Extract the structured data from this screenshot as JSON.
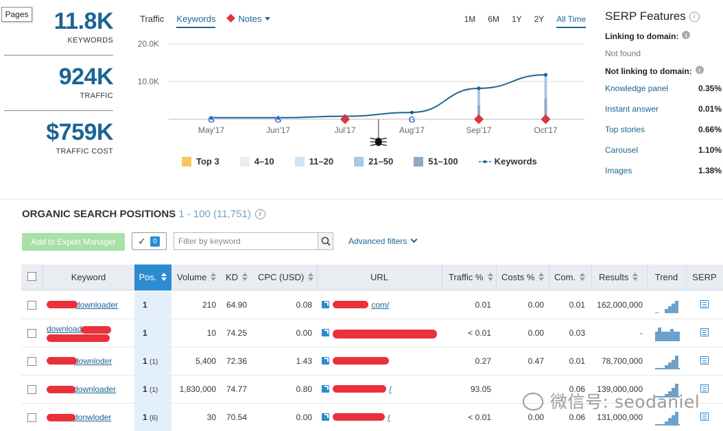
{
  "pages_tab": "Pages",
  "stats": [
    {
      "value": "11.8K",
      "label": "KEYWORDS"
    },
    {
      "value": "924K",
      "label": "TRAFFIC"
    },
    {
      "value": "$759K",
      "label": "TRAFFIC COST"
    }
  ],
  "chart_tabs": {
    "traffic": "Traffic",
    "keywords": "Keywords",
    "notes": "Notes"
  },
  "time_ranges": [
    "1M",
    "6M",
    "1Y",
    "2Y",
    "All Time"
  ],
  "chart_data": {
    "type": "line",
    "x": [
      "May'17",
      "Jun'17",
      "Jul'17",
      "Aug'17",
      "Sep'17",
      "Oct'17"
    ],
    "series": [
      {
        "name": "Keywords",
        "values": [
          400,
          400,
          800,
          1800,
          8200,
          11800
        ]
      }
    ],
    "yticks": [
      "20.0K",
      "10.0K"
    ],
    "ylim": [
      0,
      20000
    ],
    "markers": {
      "google": [
        "May'17",
        "Jun'17",
        "Aug'17"
      ],
      "notes": [
        "Jul'17",
        "Sep'17",
        "Oct'17"
      ]
    },
    "grid": true
  },
  "legend": [
    {
      "label": "Top 3",
      "color": "#f5c760"
    },
    {
      "label": "4–10",
      "color": "#e8eef4"
    },
    {
      "label": "11–20",
      "color": "#cfe3f3"
    },
    {
      "label": "21–50",
      "color": "#a9c8e4"
    },
    {
      "label": "51–100",
      "color": "#8fa9c6"
    },
    {
      "label": "Keywords",
      "color": "#1a6496"
    }
  ],
  "serp": {
    "title": "SERP Features",
    "linking": "Linking to domain:",
    "not_found": "Not found",
    "not_linking": "Not linking to domain:",
    "features": [
      {
        "name": "Knowledge panel",
        "value": "0.35%"
      },
      {
        "name": "Instant answer",
        "value": "0.01%"
      },
      {
        "name": "Top stories",
        "value": "0.66%"
      },
      {
        "name": "Carousel",
        "value": "1.10%"
      },
      {
        "name": "Images",
        "value": "1.38%"
      }
    ]
  },
  "organic": {
    "title": "ORGANIC SEARCH POSITIONS",
    "range": "1 - 100 (11,751)"
  },
  "toolbar": {
    "add_btn": "Add to Export Manager",
    "count": "0",
    "filter_placeholder": "Filter by keyword",
    "advanced": "Advanced filters"
  },
  "columns": [
    "Keyword",
    "Pos.",
    "Volume",
    "KD",
    "CPC (USD)",
    "URL",
    "Traffic %",
    "Costs %",
    "Com.",
    "Results",
    "Trend",
    "SERP"
  ],
  "rows": [
    {
      "keyword": "downloader",
      "pos": "1",
      "prev": "",
      "volume": "210",
      "kd": "64.90",
      "cpc": "0.08",
      "url": "com/",
      "traffic": "0.01",
      "costs": "0.00",
      "com": "0.01",
      "results": "162,000,000"
    },
    {
      "keyword": "download",
      "pos": "1",
      "prev": "",
      "volume": "10",
      "kd": "74.25",
      "cpc": "0.00",
      "url": "",
      "traffic": "< 0.01",
      "costs": "0.00",
      "com": "0.03",
      "results": "-"
    },
    {
      "keyword": "downloder",
      "pos": "1",
      "prev": "(1)",
      "volume": "5,400",
      "kd": "72.36",
      "cpc": "1.43",
      "url": "",
      "traffic": "0.27",
      "costs": "0.47",
      "com": "0.01",
      "results": "78,700,000"
    },
    {
      "keyword": "downloader",
      "pos": "1",
      "prev": "(1)",
      "volume": "1,830,000",
      "kd": "74.77",
      "cpc": "0.80",
      "url": "/",
      "traffic": "93.05",
      "costs": "",
      "com": "0.06",
      "results": "139,000,000"
    },
    {
      "keyword": "donwloder",
      "pos": "1",
      "prev": "(6)",
      "volume": "30",
      "kd": "70.54",
      "cpc": "0.00",
      "url": "/",
      "traffic": "< 0.01",
      "costs": "0.00",
      "com": "0.06",
      "results": "131,000,000"
    }
  ],
  "watermark": "微信号: seodaniel"
}
